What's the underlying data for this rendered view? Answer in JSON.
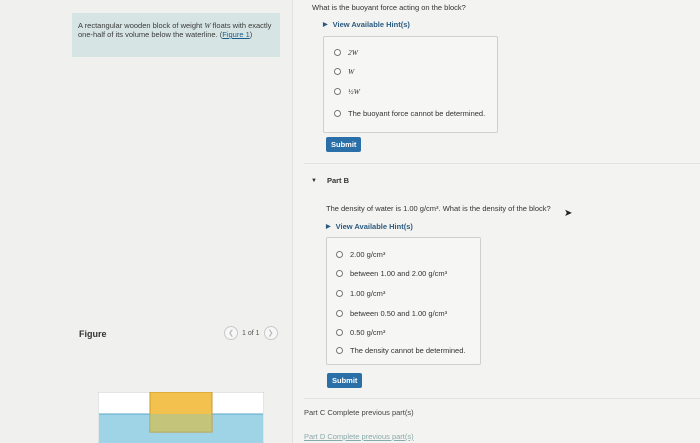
{
  "problem": {
    "text_1": "A rectangular wooden block of weight ",
    "var": "W",
    "text_2": " floats with exactly one-half of its volume below the waterline. (",
    "link": "Figure 1",
    "text_3": ")"
  },
  "figure": {
    "label": "Figure",
    "pager_text": "1 of 1",
    "prev_icon": "chevron-left-icon",
    "next_icon": "chevron-right-icon"
  },
  "part_a": {
    "question": "What is the buoyant force acting on the block?",
    "hint_label": "View Available Hint(s)",
    "options": [
      "2W",
      "W",
      "½W",
      "The buoyant force cannot be determined."
    ],
    "submit": "Submit"
  },
  "part_b": {
    "label": "Part B",
    "question": "The density of water is 1.00 g/cm³. What is the density of the block?",
    "hint_label": "View Available Hint(s)",
    "options": [
      "2.00 g/cm³",
      "between 1.00 and 2.00 g/cm³",
      "1.00 g/cm³",
      "between 0.50 and 1.00 g/cm³",
      "0.50 g/cm³",
      "The density cannot be determined."
    ],
    "submit": "Submit"
  },
  "part_c": {
    "text": "Part C  Complete previous part(s)"
  },
  "part_d": {
    "text": "Part D  Complete previous part(s)"
  },
  "colors": {
    "accent": "#2a6fa8",
    "problem_bg": "#d6e5e3",
    "water": "#9fd3e6",
    "block": "#f2c14e"
  }
}
